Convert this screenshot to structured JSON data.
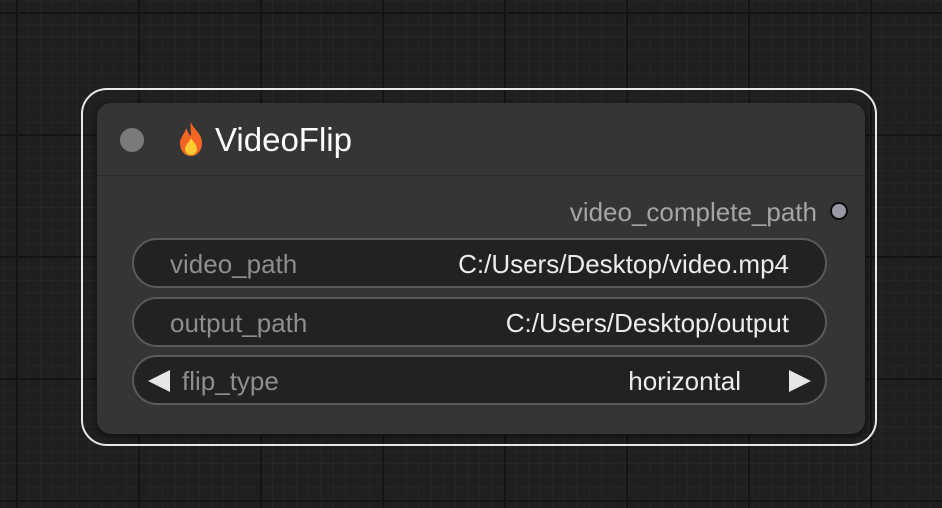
{
  "node": {
    "title": "VideoFlip",
    "title_icon": "fire-icon",
    "outputs": [
      {
        "label": "video_complete_path"
      }
    ],
    "widgets": {
      "video_path": {
        "label": "video_path",
        "value": "C:/Users/Desktop/video.mp4"
      },
      "output_path": {
        "label": "output_path",
        "value": "C:/Users/Desktop/output"
      },
      "flip_type": {
        "label": "flip_type",
        "value": "horizontal"
      }
    }
  },
  "colors": {
    "canvas_background": "#1f1f1f",
    "node_body": "#353535",
    "selection_outline": "#e8e8e8",
    "widget_background": "#222222",
    "output_slot": "#9a9aa6",
    "fire_outer": "#f26522",
    "fire_inner": "#ffcc33"
  }
}
